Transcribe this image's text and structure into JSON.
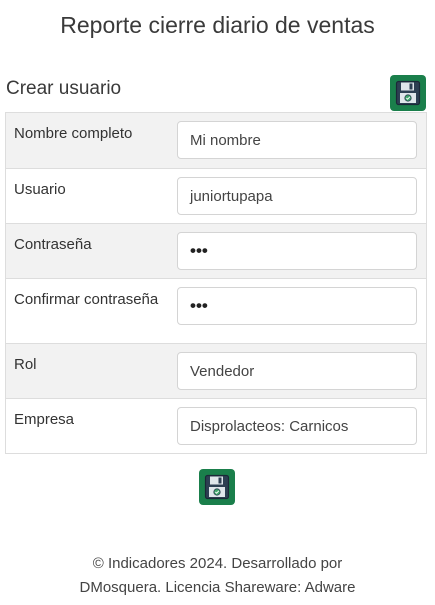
{
  "header": {
    "title": "Reporte cierre diario de ventas"
  },
  "section": {
    "title": "Crear usuario"
  },
  "form": {
    "rows": [
      {
        "label": "Nombre completo",
        "value": "Mi nombre"
      },
      {
        "label": "Usuario",
        "value": "juniortupapa"
      },
      {
        "label": "Contraseña",
        "value": "•••"
      },
      {
        "label": "Confirmar contraseña",
        "value": "•••"
      },
      {
        "label": "Rol",
        "value": "Vendedor"
      },
      {
        "label": "Empresa",
        "value": "Disprolacteos: Carnicos"
      }
    ]
  },
  "actions": {
    "save_icon": "floppy-disk-icon",
    "accent_color": "#1a7f4b"
  },
  "footer": {
    "line1": "© Indicadores 2024. Desarrollado por",
    "line2": "DMosquera. Licencia Shareware: Adware"
  }
}
